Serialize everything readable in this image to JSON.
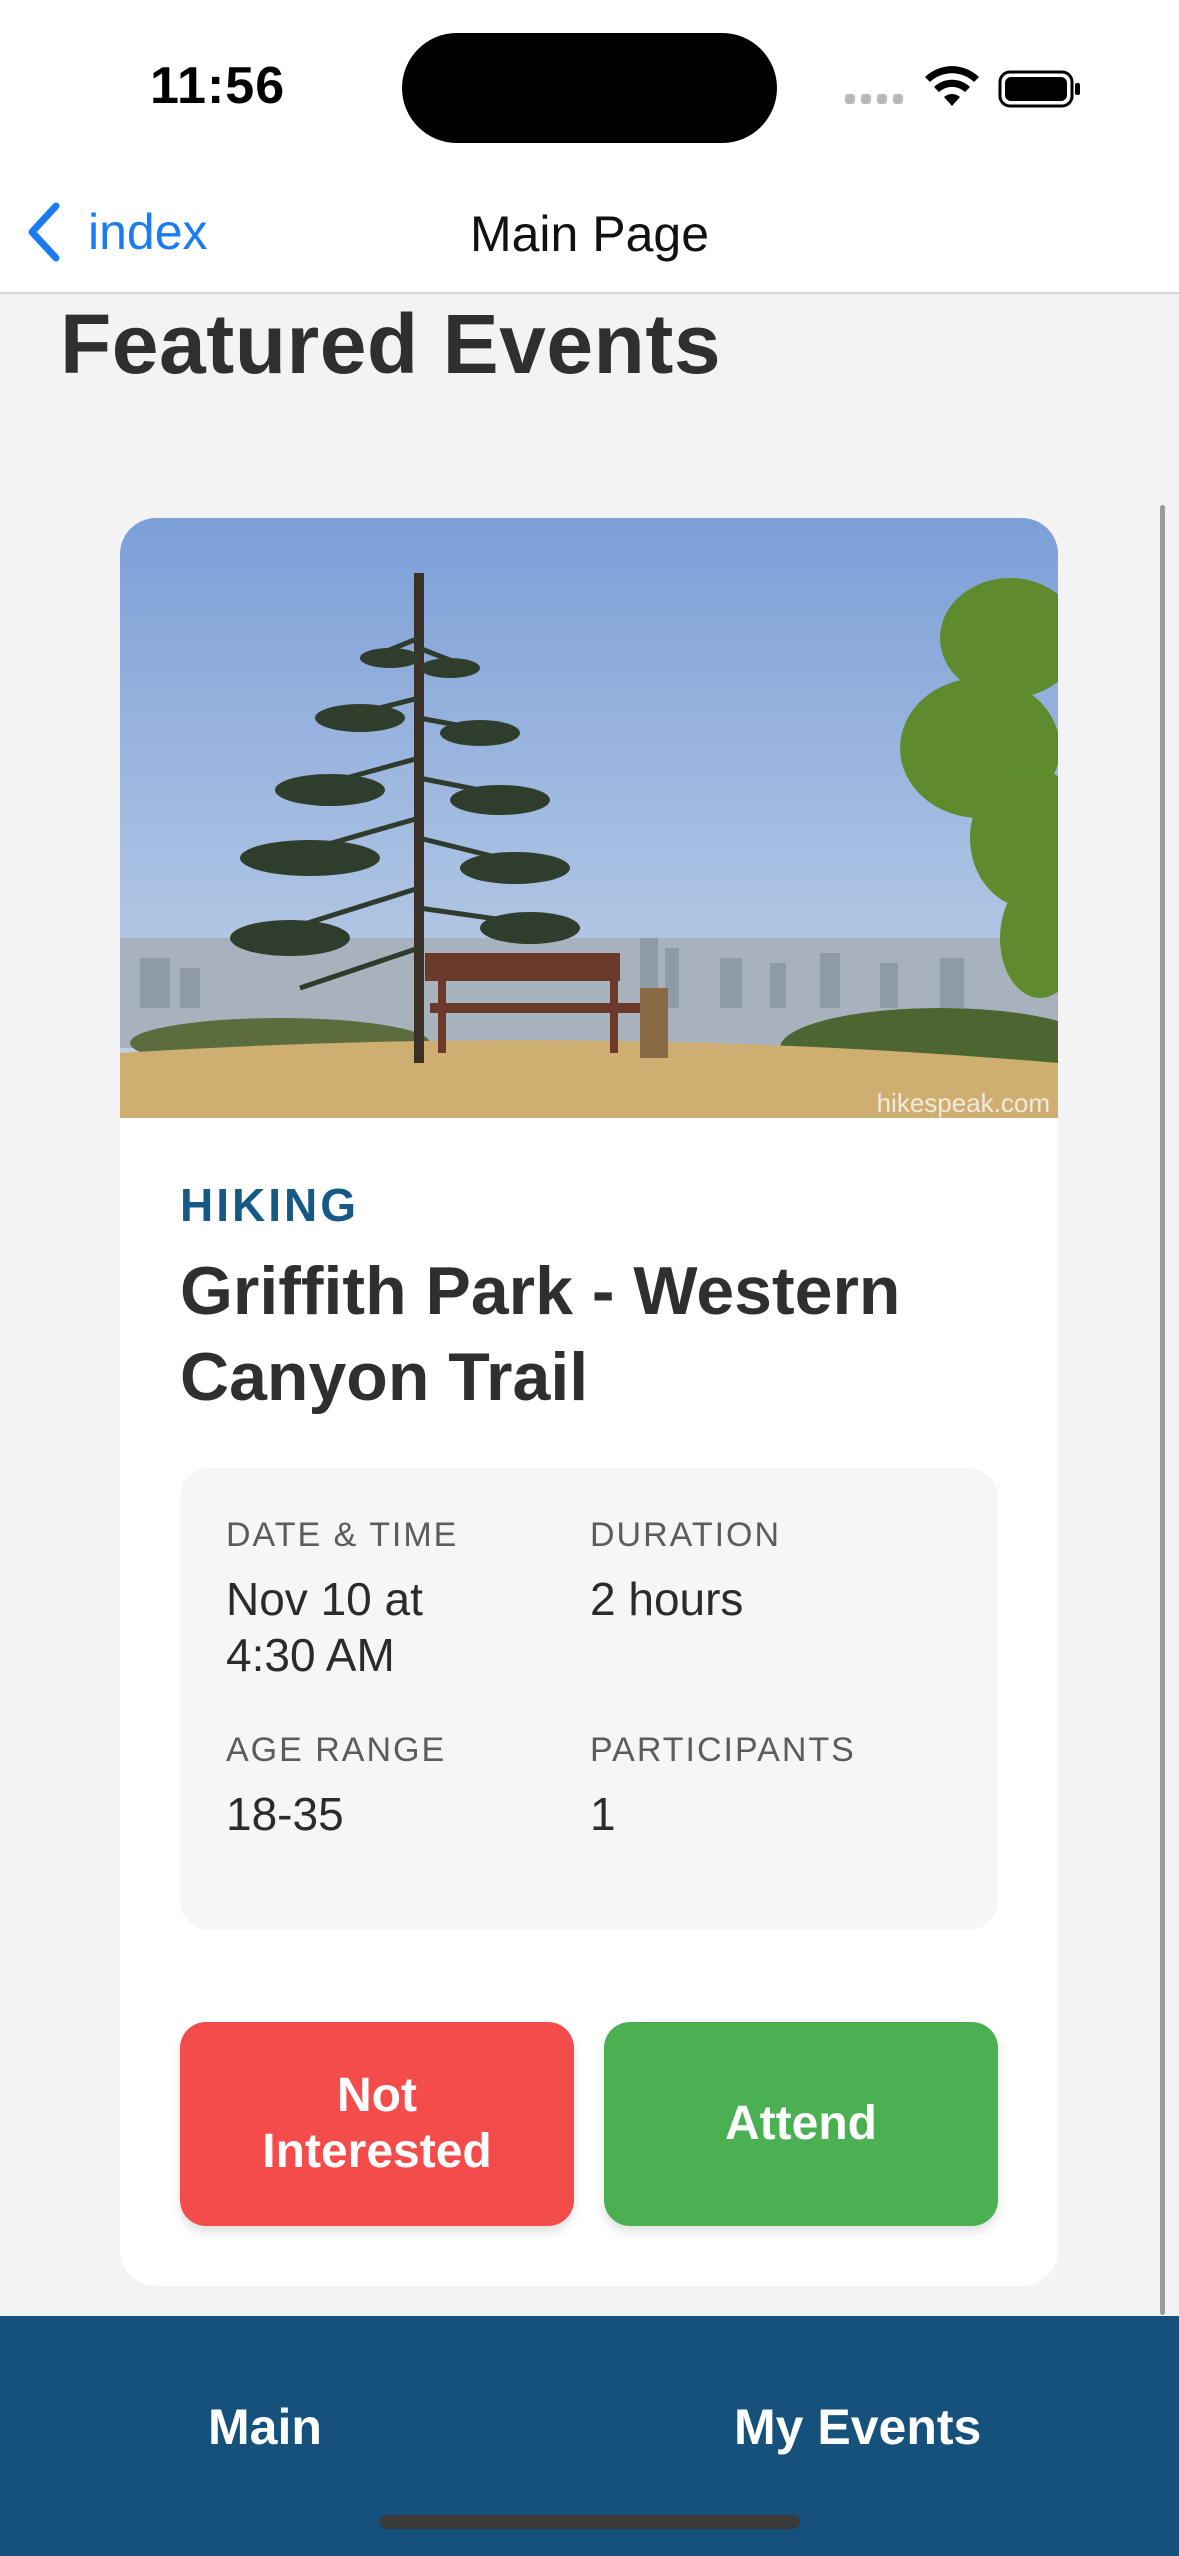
{
  "status_bar": {
    "time": "11:56",
    "icons": [
      "signal-icon",
      "wifi-icon",
      "battery-icon"
    ]
  },
  "nav": {
    "back_label": "index",
    "title": "Main Page"
  },
  "page": {
    "title": "Featured Events"
  },
  "event": {
    "category": "HIKING",
    "title": "Griffith Park - Western Canyon Trail",
    "image_watermark": "hikespeak.com",
    "details": [
      {
        "label": "DATE & TIME",
        "value": "Nov 10 at 4:30 AM"
      },
      {
        "label": "DURATION",
        "value": "2 hours"
      },
      {
        "label": "AGE RANGE",
        "value": "18-35"
      },
      {
        "label": "PARTICIPANTS",
        "value": "1"
      }
    ],
    "actions": {
      "decline_label": "Not Interested",
      "accept_label": "Attend"
    }
  },
  "tabs": [
    {
      "label": "Main"
    },
    {
      "label": "My Events"
    }
  ],
  "colors": {
    "accent_blue": "#1a7bf2",
    "category_blue": "#155a86",
    "tab_bar": "#15517b",
    "decline_red": "#f44b4b",
    "accept_green": "#4bb051"
  }
}
